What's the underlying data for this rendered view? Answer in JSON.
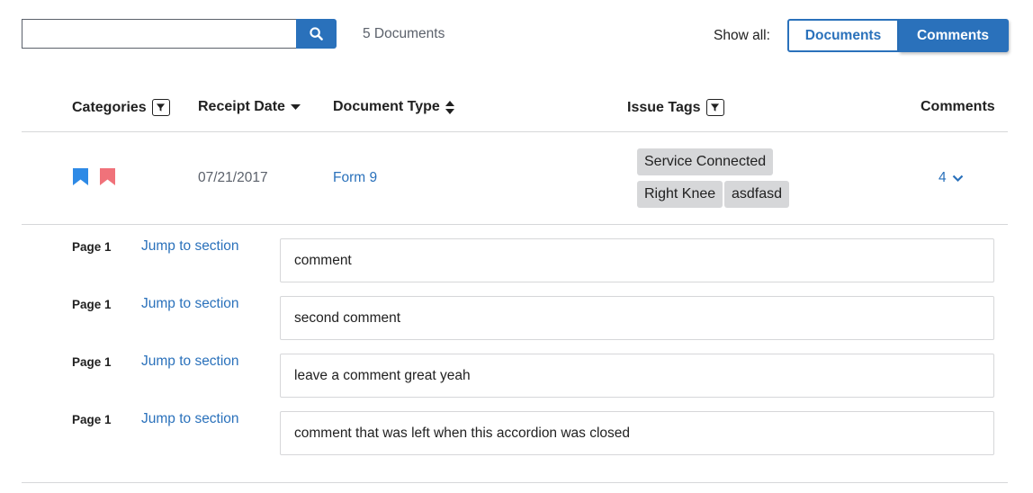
{
  "search": {
    "value": "",
    "placeholder": ""
  },
  "document_count": "5 Documents",
  "show_all": {
    "label": "Show all:",
    "options": [
      "Documents",
      "Comments"
    ],
    "selected": "Comments"
  },
  "columns": {
    "categories": "Categories",
    "receipt_date": "Receipt Date",
    "document_type": "Document Type",
    "issue_tags": "Issue Tags",
    "comments": "Comments"
  },
  "document": {
    "categories": [
      {
        "icon": "bookmark-icon",
        "color": "#2e8ae6"
      },
      {
        "icon": "bookmark-icon",
        "color": "#f0727a"
      }
    ],
    "receipt_date": "07/21/2017",
    "document_type": "Form 9",
    "issue_tags": [
      "Service Connected",
      "Right Knee",
      "asdfasd"
    ],
    "comment_count": "4"
  },
  "comments": [
    {
      "page": "Page 1",
      "jump": "Jump to section",
      "text": "comment"
    },
    {
      "page": "Page 1",
      "jump": "Jump to section",
      "text": "second comment"
    },
    {
      "page": "Page 1",
      "jump": "Jump to section",
      "text": "leave a comment great yeah"
    },
    {
      "page": "Page 1",
      "jump": "Jump to section",
      "text": "comment that was left when this accordion was closed"
    }
  ],
  "colors": {
    "primary": "#2a71bb",
    "tag_bg": "#d6d7d9",
    "text": "#212121",
    "muted": "#5b616b"
  }
}
